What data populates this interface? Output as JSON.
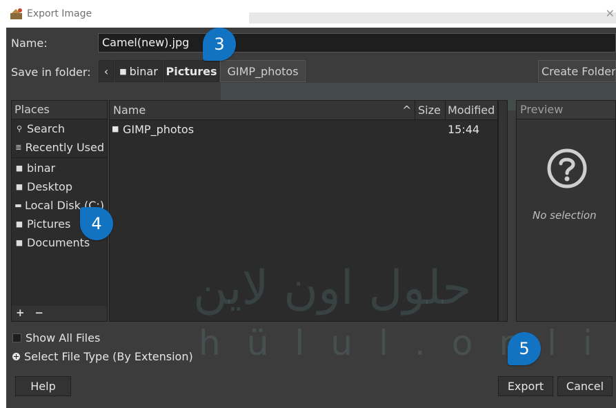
{
  "window": {
    "title": "Export Image",
    "close_glyph": "✕"
  },
  "name_row": {
    "label": "Name:",
    "value": "Camel(new).jpg"
  },
  "folder_row": {
    "label": "Save in folder:",
    "back_glyph": "‹",
    "path": [
      {
        "label": "binar",
        "icon": "folder-icon"
      },
      {
        "label": "Pictures",
        "current": true
      },
      {
        "label": "GIMP_photos"
      }
    ],
    "create_folder": "Create Folder"
  },
  "places": {
    "header": "Places",
    "system": [
      {
        "label": "Search",
        "icon": "search-icon"
      },
      {
        "label": "Recently Used",
        "icon": "recent-icon"
      }
    ],
    "bookmarks": [
      {
        "label": "binar",
        "icon": "folder-icon"
      },
      {
        "label": "Desktop",
        "icon": "folder-icon"
      },
      {
        "label": "Local Disk (C:)",
        "icon": "drive-icon"
      },
      {
        "label": "Pictures",
        "icon": "folder-icon"
      },
      {
        "label": "Documents",
        "icon": "folder-icon"
      }
    ],
    "add_glyph": "+",
    "remove_glyph": "−"
  },
  "files": {
    "columns": {
      "name": "Name",
      "sort_glyph": "^",
      "size": "Size",
      "modified": "Modified"
    },
    "rows": [
      {
        "name": "GIMP_photos",
        "size": "",
        "modified": "15:44",
        "icon": "folder-icon"
      }
    ]
  },
  "preview": {
    "header": "Preview",
    "icon": "question-icon",
    "empty_text": "No selection"
  },
  "options": {
    "show_all_files": "Show All Files",
    "select_file_type": "Select File Type (By Extension)"
  },
  "buttons": {
    "help": "Help",
    "export": "Export",
    "cancel": "Cancel"
  },
  "callouts": {
    "name": "3",
    "pictures": "4",
    "export": "5"
  },
  "watermark": {
    "arabic": "حلول اون لاين",
    "latin": "hülul.online"
  },
  "colors": {
    "dialog_bg": "#3c3c3c",
    "callout": "#1273c2"
  }
}
